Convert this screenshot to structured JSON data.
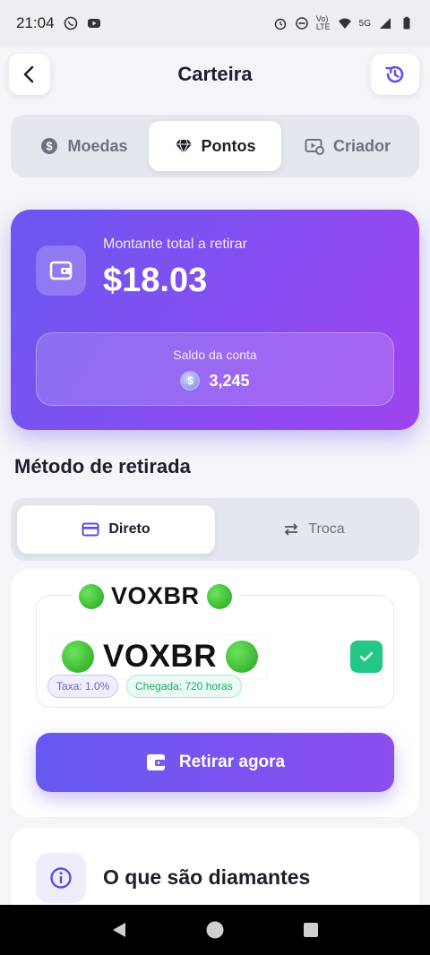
{
  "status_bar": {
    "time": "21:04",
    "network": "5G"
  },
  "header": {
    "title": "Carteira",
    "back_icon": "back-arrow-icon",
    "history_icon": "history-icon",
    "accent": "#6a4de8"
  },
  "tabs": [
    {
      "label": "Moedas",
      "icon": "dollar-coin-icon",
      "active": false
    },
    {
      "label": "Pontos",
      "icon": "diamond-icon",
      "active": true
    },
    {
      "label": "Criador",
      "icon": "video-settings-icon",
      "active": false
    }
  ],
  "balance": {
    "amount_label": "Montante total a retirar",
    "amount": "$18.03",
    "account_label": "Saldo da conta",
    "account_value": "3,245",
    "gradient_start": "#6a58f0",
    "gradient_end": "#9d44ef"
  },
  "method": {
    "section_title": "Método de retirada",
    "tabs": [
      {
        "label": "Direto",
        "icon": "card-icon",
        "active": true
      },
      {
        "label": "Troca",
        "icon": "swap-icon",
        "active": false
      }
    ],
    "option": {
      "brand_small": "VOXBR",
      "brand_big": "VOXBR",
      "fee_chip": "Taxa: 1.0%",
      "eta_chip": "Chegada: 720 horas",
      "selected": true,
      "check_color": "#22c783"
    },
    "withdraw_label": "Retirar agora"
  },
  "info": {
    "title": "O que são diamantes",
    "icon": "info-icon"
  }
}
